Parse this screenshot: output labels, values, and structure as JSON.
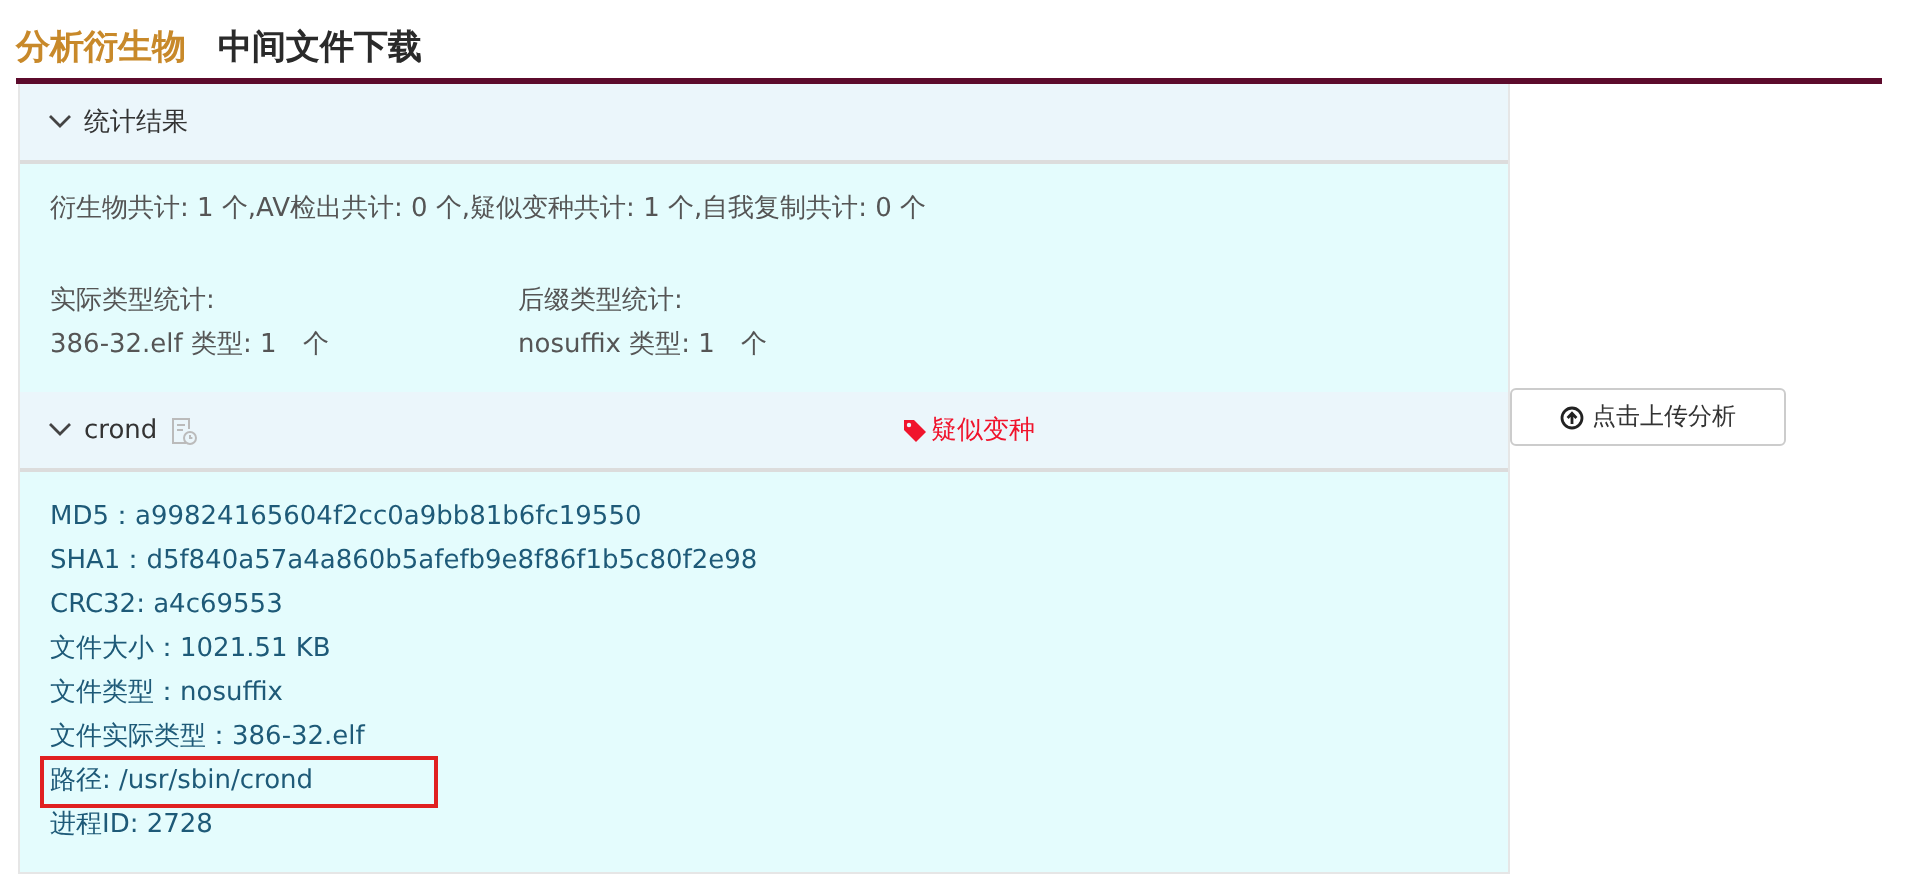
{
  "tabs": [
    {
      "label": "分析衍生物",
      "selected": true
    },
    {
      "label": "中间文件下载",
      "selected": false
    }
  ],
  "sections": [
    {
      "title": "统计结果",
      "expanded": true,
      "summary": "衍生物共计: 1 个,AV检出共计: 0 个,疑似变种共计: 1 个,自我复制共计: 0 个",
      "stats": [
        {
          "heading": "实际类型统计:",
          "value": "386-32.elf 类型: 1　个"
        },
        {
          "heading": "后缀类型统计:",
          "value": "nosuffix 类型: 1　个"
        }
      ]
    },
    {
      "title": "crond",
      "expanded": true,
      "tag": "疑似变种",
      "fields": [
        {
          "text": "MD5：a99824165604f2cc0a9bb81b6fc19550",
          "highlighted": false
        },
        {
          "text": "SHA1：d5f840a57a4a860b5afefb9e8f86f1b5c80f2e98",
          "highlighted": false
        },
        {
          "text": "CRC32: a4c69553",
          "highlighted": false
        },
        {
          "text": "文件大小：1021.51 KB",
          "highlighted": false
        },
        {
          "text": "文件类型：nosuffix",
          "highlighted": false
        },
        {
          "text": "文件实际类型：386-32.elf",
          "highlighted": false
        },
        {
          "text": "路径: /usr/sbin/crond",
          "highlighted": true
        },
        {
          "text": "进程ID: 2728",
          "highlighted": false
        }
      ]
    }
  ],
  "upload_button": "点击上传分析"
}
